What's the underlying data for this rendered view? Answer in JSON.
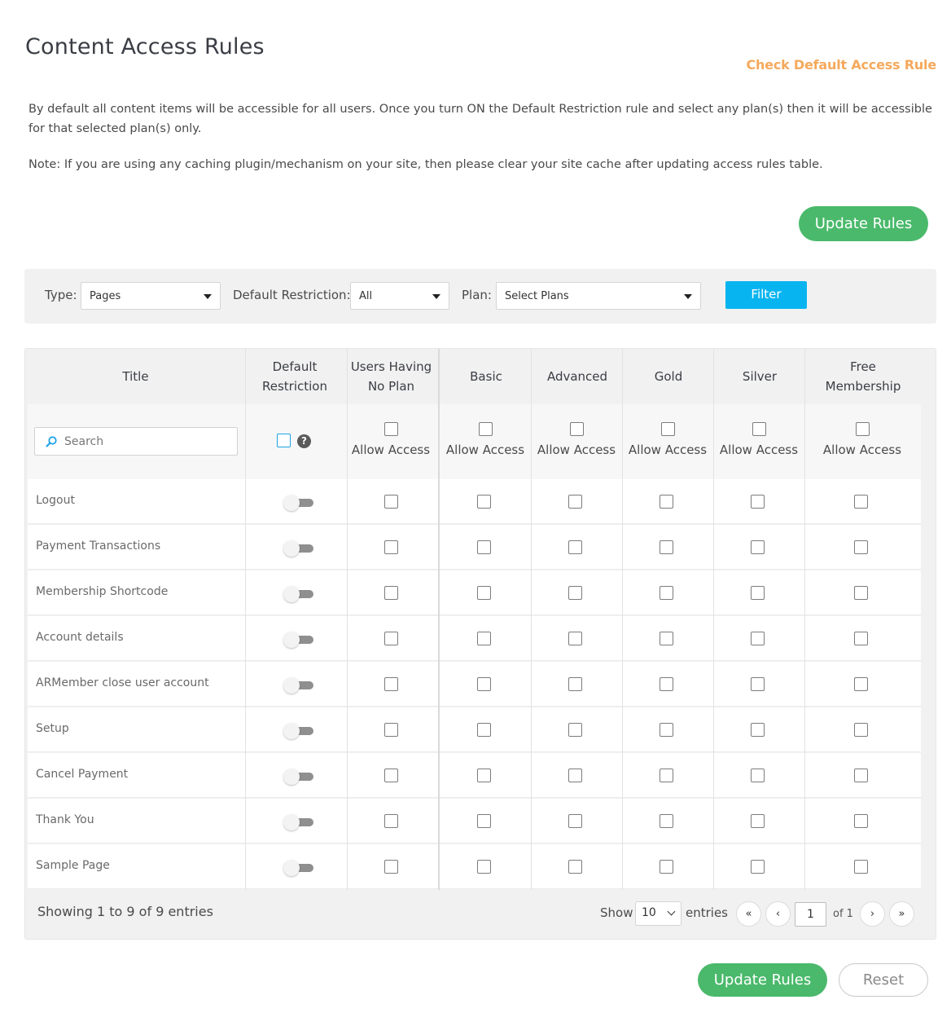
{
  "page": {
    "title": "Content Access Rules",
    "check_link": "Check Default Access Rule",
    "description": "By default all content items will be accessible for all users. Once you turn ON the Default Restriction rule and select any plan(s) then it will be accessible for that selected plan(s) only.",
    "note": "Note: If you are using any caching plugin/mechanism on your site, then please clear your site cache after updating access rules table.",
    "update_label": "Update Rules",
    "reset_label": "Reset"
  },
  "filters": {
    "type_label": "Type:",
    "type_value": "Pages",
    "restriction_label": "Default Restriction:",
    "restriction_value": "All",
    "plan_label": "Plan:",
    "plan_value": "Select Plans",
    "filter_label": "Filter"
  },
  "table": {
    "columns": {
      "title": "Title",
      "default_restriction": "Default Restriction",
      "no_plan": "Users Having No Plan",
      "basic": "Basic",
      "advanced": "Advanced",
      "gold": "Gold",
      "silver": "Silver",
      "free": "Free Membership"
    },
    "search_placeholder": "Search",
    "allow_access_label": "Allow Access",
    "rows": [
      {
        "title": "Logout"
      },
      {
        "title": "Payment Transactions"
      },
      {
        "title": "Membership Shortcode"
      },
      {
        "title": "Account details"
      },
      {
        "title": "ARMember close user account"
      },
      {
        "title": "Setup"
      },
      {
        "title": "Cancel Payment"
      },
      {
        "title": "Thank You"
      },
      {
        "title": "Sample Page"
      }
    ]
  },
  "pagination": {
    "info": "Showing 1 to 9 of 9 entries",
    "show_label": "Show",
    "per_page": "10",
    "entries_label": "entries",
    "first": "«",
    "prev": "‹",
    "current_page": "1",
    "of_label": "of 1",
    "next": "›",
    "last": "»"
  },
  "colors": {
    "accent_green": "#4ab96b",
    "link_orange": "#f5a95c",
    "filter_blue": "#08b4f0"
  },
  "icons": [
    "search-icon",
    "help-icon",
    "dropdown-arrow-icon",
    "chevron-down-icon"
  ]
}
